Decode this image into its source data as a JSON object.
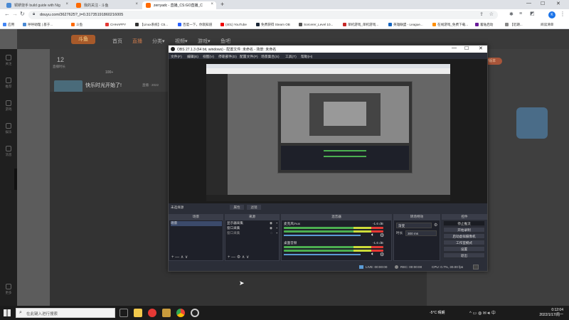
{
  "browser": {
    "tabs": [
      {
        "title": "铜锣烧手 build guide with Nig",
        "color": "#4a8ad4"
      },
      {
        "title": "我的关注 - 斗鱼",
        "color": "#ff6a00"
      },
      {
        "title": "zerryadc - 直播_CS:GO直播_C",
        "color": "#ff6a00"
      }
    ],
    "new_tab": "+",
    "window_controls": [
      "—",
      "☐",
      "✕"
    ],
    "url": "douyu.com/3627625?_t=0.31735191860216005",
    "bookmarks": [
      "应用",
      "呼呼助理 | 基于...",
      "斗鱼",
      "CHHAPPY",
      "【Linux系统】C5...",
      "百度一下，你就知道",
      "(401) YouTube",
      "免费获得 Steam OB",
      "Sorcerer_Level 10...",
      "单机游戏_单机游戏...",
      "英雄联盟 - League...",
      "在线游戏_免费下载...",
      "着陆启动",
      "【近期..."
    ],
    "reading_list": "阅读清单"
  },
  "site": {
    "nav": [
      "首页",
      "直播",
      "分类▾",
      "视频▾",
      "游戏▾",
      "鱼吧"
    ],
    "stats": {
      "value": "12",
      "label": "直播时长"
    },
    "streamer_title": "快乐时光开始了!",
    "streamer_meta": "直播 · 2022",
    "follow_count": "100+",
    "pcv_badge": "PCV版本",
    "side_items": [
      "关注",
      "推荐",
      "游戏",
      "娱乐",
      "消息",
      "更多"
    ]
  },
  "obs": {
    "title": "OBS 27.1.3 (64 bit, windows) - 配置文件: 未命名 - 场景: 未命名",
    "menu": [
      "文件(F)",
      "编辑(E)",
      "视图(V)",
      "停靠部件(D)",
      "配置文件(P)",
      "场景集合(S)",
      "工具(T)",
      "帮助(H)"
    ],
    "preview_label": "未选择源",
    "preview_buttons": [
      "属性",
      "滤镜"
    ],
    "panels": {
      "scenes": "场景",
      "sources": "来源",
      "mixer": "混音器",
      "transitions": "转场特效",
      "controls": "控件"
    },
    "scene_items": [
      "场景"
    ],
    "source_items": [
      "显示器采集",
      "窗口采集",
      "窗口采集"
    ],
    "mixer": [
      {
        "name": "麦克风/Aux",
        "db": "-1.6 dB"
      },
      {
        "name": "桌面音频",
        "db": "-1.6 dB"
      }
    ],
    "transition": {
      "type": "渐变",
      "duration_label": "时长",
      "duration": "300 ms"
    },
    "controls": [
      "停止推流",
      "开始录制",
      "启动虚拟摄像机",
      "工作室模式",
      "设置",
      "退出"
    ],
    "status": {
      "live": "LIVE: 00:00:00",
      "rec": "REC: 00:00:00",
      "cpu": "CPU: 0.7%, 30.00 fps"
    }
  },
  "taskbar": {
    "search_placeholder": "在此键入进行搜索",
    "weather": "-5°C 晴朗",
    "time": "0:12:04",
    "date": "2022/1/17/周一"
  }
}
